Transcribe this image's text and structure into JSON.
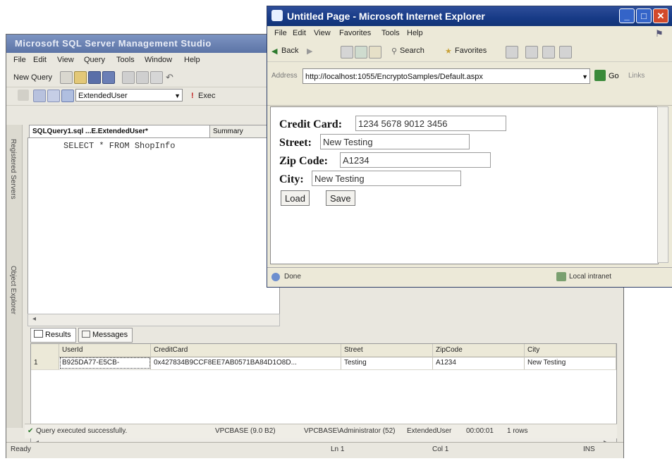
{
  "ssms": {
    "title": "Microsoft SQL Server Management Studio",
    "menu": [
      "File",
      "Edit",
      "View",
      "Query",
      "Tools",
      "Window",
      "Help"
    ],
    "toolbar": {
      "new_query": "New Query",
      "database": "ExtendedUser",
      "execute": "Exec"
    },
    "left_strip": [
      "Registered Servers",
      "Object Explorer"
    ],
    "doc_tabs": [
      "SQLQuery1.sql ...E.ExtendedUser*",
      "Summary"
    ],
    "query_text": "SELECT * FROM ShopInfo",
    "results_tabs": [
      "Results",
      "Messages"
    ],
    "grid": {
      "columns": [
        "UserId",
        "CreditCard",
        "Street",
        "ZipCode",
        "City"
      ],
      "rows": [
        {
          "num": "1",
          "cells": [
            "B925DA77-E5CB-",
            "0x427834B9CCF8EE7AB0571BA84D1O8D...",
            "Testing",
            "A1234",
            "New Testing"
          ]
        }
      ]
    },
    "query_status": {
      "message": "Query executed successfully.",
      "server": "VPCBASE (9.0 B2)",
      "login": "VPCBASE\\Administrator (52)",
      "database": "ExtendedUser",
      "time": "00:00:01",
      "rows": "1 rows"
    },
    "statusbar": {
      "ready": "Ready",
      "line": "Ln 1",
      "col": "Col 1",
      "mode": "INS"
    }
  },
  "ie": {
    "title": "Untitled Page - Microsoft Internet Explorer",
    "menu": [
      "File",
      "Edit",
      "View",
      "Favorites",
      "Tools",
      "Help"
    ],
    "toolbar": {
      "back": "Back",
      "search": "Search",
      "favorites": "Favorites"
    },
    "address_label": "Address",
    "address": "http://localhost:1055/EncryptoSamples/Default.aspx",
    "go": "Go",
    "links": "Links",
    "form": {
      "credit_card_label": "Credit Card:",
      "credit_card_value": "1234 5678 9012 3456",
      "street_label": "Street:",
      "street_value": "New Testing",
      "zip_label": "Zip Code:",
      "zip_value": "A1234",
      "city_label": "City:",
      "city_value": "New Testing",
      "load": "Load",
      "save": "Save"
    },
    "status": {
      "done": "Done",
      "zone": "Local intranet"
    }
  }
}
